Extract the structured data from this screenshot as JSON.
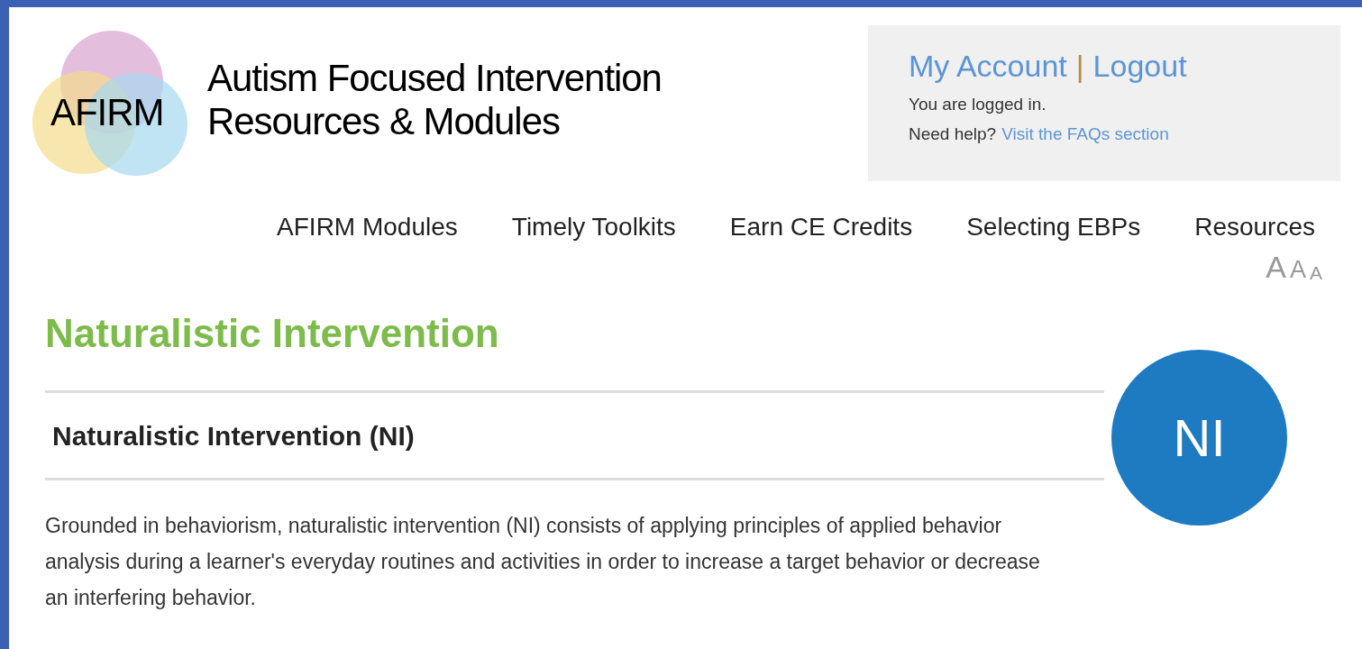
{
  "logo": {
    "text": "AFIRM"
  },
  "site_title": [
    "Autism Focused Intervention",
    "Resources & Modules"
  ],
  "account": {
    "links": [
      "My Account",
      "Logout"
    ],
    "separator": "|",
    "status": "You are logged in.",
    "help_prefix": "Need help?",
    "help_link": "Visit the FAQs section"
  },
  "nav": [
    "AFIRM Modules",
    "Timely Toolkits",
    "Earn CE Credits",
    "Selecting EBPs",
    "Resources"
  ],
  "font_size_controls": [
    "A",
    "A",
    "A"
  ],
  "page_title": "Naturalistic Intervention",
  "section": {
    "title": "Naturalistic Intervention (NI)",
    "badge": "NI",
    "description": "Grounded in behaviorism, naturalistic intervention (NI) consists of applying principles of applied behavior analysis during a learner's everyday routines and activities in order to increase a target behavior or decrease an interfering behavior."
  }
}
